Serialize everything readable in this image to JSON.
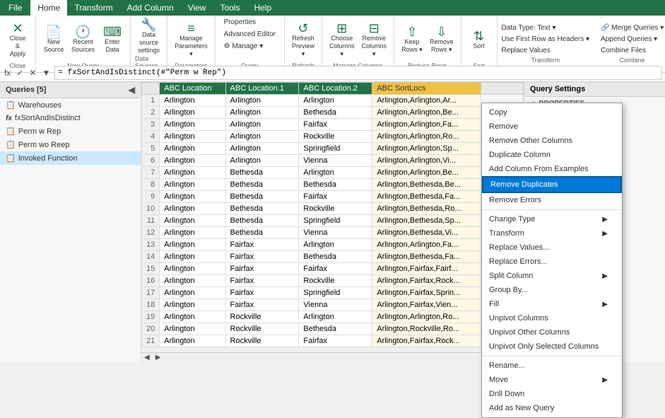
{
  "ribbon": {
    "tabs": [
      "File",
      "Home",
      "Transform",
      "Add Column",
      "View",
      "Tools",
      "Help"
    ],
    "active_tab": "Home",
    "groups": [
      {
        "label": "Close",
        "items": [
          {
            "label": "Close &\nApply",
            "icon": "✕"
          }
        ]
      },
      {
        "label": "New Query",
        "items": [
          {
            "label": "New\nSource",
            "icon": "📄"
          },
          {
            "label": "Recent\nSources",
            "icon": "🕐"
          },
          {
            "label": "Enter\nData",
            "icon": "⌨"
          }
        ]
      },
      {
        "label": "Data Sources",
        "items": [
          {
            "label": "Data source\nsettings",
            "icon": "🔧"
          }
        ]
      },
      {
        "label": "Parameters",
        "items": [
          {
            "label": "Manage\nParameters",
            "icon": "≡"
          }
        ]
      },
      {
        "label": "Query",
        "items": [
          {
            "label": "Properties",
            "icon": ""
          },
          {
            "label": "Advanced Editor",
            "icon": ""
          },
          {
            "label": "Manage ▾",
            "icon": ""
          }
        ]
      },
      {
        "label": "Refresh",
        "items": [
          {
            "label": "Refresh\nPreview ▾",
            "icon": "↺"
          }
        ]
      },
      {
        "label": "Manage Columns",
        "items": [
          {
            "label": "Choose\nColumns ▾",
            "icon": ""
          },
          {
            "label": "Remove\nColumns ▾",
            "icon": ""
          }
        ]
      },
      {
        "label": "Reduce Rows",
        "items": [
          {
            "label": "Keep\nRows ▾",
            "icon": ""
          },
          {
            "label": "Remove\nRows ▾",
            "icon": ""
          }
        ]
      },
      {
        "label": "Sort",
        "items": [
          {
            "label": "Sort",
            "icon": ""
          }
        ]
      }
    ]
  },
  "formula_bar": {
    "name_box_value": "= fxSortAndIsDistinct(#\"Perm w Rep\")",
    "formula_value": "= fxSortAndIsDistinct(#\"Perm w Rep\")"
  },
  "sidebar": {
    "header": "Queries [5]",
    "items": [
      {
        "label": "Warehouses",
        "icon": "📋",
        "active": false
      },
      {
        "label": "fxSortAndIsDistinct",
        "icon": "fx",
        "active": false
      },
      {
        "label": "Perm w Rep",
        "icon": "📋",
        "active": false
      },
      {
        "label": "Perm wo Reep",
        "icon": "📋",
        "active": false
      },
      {
        "label": "Invoked Function",
        "icon": "📋",
        "active": true
      }
    ]
  },
  "grid": {
    "columns": [
      "",
      "Location",
      "Location.1",
      "Location.2",
      "SortLocs"
    ],
    "rows": [
      [
        "1",
        "Arlington",
        "Arlington",
        "Arlington",
        "Arlington,Arlington,Ar..."
      ],
      [
        "2",
        "Arlington",
        "Arlington",
        "Bethesda",
        "Arlington,Arlington,Be..."
      ],
      [
        "3",
        "Arlington",
        "Arlington",
        "Fairfax",
        "Arlington,Arlington,Fa..."
      ],
      [
        "4",
        "Arlington",
        "Arlington",
        "Rockville",
        "Arlington,Arlington,Ro..."
      ],
      [
        "5",
        "Arlington",
        "Arlington",
        "Springfield",
        "Arlington,Arlington,Sp..."
      ],
      [
        "6",
        "Arlington",
        "Arlington",
        "Vienna",
        "Arlington,Arlington,Vi..."
      ],
      [
        "7",
        "Arlington",
        "Bethesda",
        "Arlington",
        "Arlington,Arlington,Be..."
      ],
      [
        "8",
        "Arlington",
        "Bethesda",
        "Bethesda",
        "Arlington,Bethesda,Be..."
      ],
      [
        "9",
        "Arlington",
        "Bethesda",
        "Fairfax",
        "Arlington,Bethesda,Fa..."
      ],
      [
        "10",
        "Arlington",
        "Bethesda",
        "Rockville",
        "Arlington,Bethesda,Ro..."
      ],
      [
        "11",
        "Arlington",
        "Bethesda",
        "Springfield",
        "Arlington,Bethesda,Sp..."
      ],
      [
        "12",
        "Arlington",
        "Bethesda",
        "Vienna",
        "Arlington,Bethesda,Vi..."
      ],
      [
        "13",
        "Arlington",
        "Fairfax",
        "Arlington",
        "Arlington,Arlington,Fa..."
      ],
      [
        "14",
        "Arlington",
        "Fairfax",
        "Bethesda",
        "Arlington,Bethesda,Fa..."
      ],
      [
        "15",
        "Arlington",
        "Fairfax",
        "Fairfax",
        "Arlington,Fairfax,Fairf..."
      ],
      [
        "16",
        "Arlington",
        "Fairfax",
        "Rockville",
        "Arlington,Fairfax,Rock..."
      ],
      [
        "17",
        "Arlington",
        "Fairfax",
        "Springfield",
        "Arlington,Fairfax,Sprin..."
      ],
      [
        "18",
        "Arlington",
        "Fairfax",
        "Vienna",
        "Arlington,Fairfax,Vien..."
      ],
      [
        "19",
        "Arlington",
        "Rockville",
        "Arlington",
        "Arlington,Arlington,Ro..."
      ],
      [
        "20",
        "Arlington",
        "Rockville",
        "Bethesda",
        "Arlington,Rockville,Ro..."
      ],
      [
        "21",
        "Arlington",
        "Rockville",
        "Fairfax",
        "Arlington,Fairfax,Rock..."
      ]
    ]
  },
  "context_menu": {
    "items": [
      {
        "label": "Copy",
        "has_arrow": false,
        "type": "item"
      },
      {
        "label": "Remove",
        "has_arrow": false,
        "type": "item"
      },
      {
        "label": "Remove Other Columns",
        "has_arrow": false,
        "type": "item"
      },
      {
        "label": "Duplicate Column",
        "has_arrow": false,
        "type": "item"
      },
      {
        "label": "Add Column From Examples",
        "has_arrow": false,
        "type": "item"
      },
      {
        "label": "Remove Duplicates",
        "has_arrow": false,
        "type": "highlighted"
      },
      {
        "label": "Remove Errors",
        "has_arrow": false,
        "type": "item"
      },
      {
        "type": "separator"
      },
      {
        "label": "Change Type",
        "has_arrow": true,
        "type": "item"
      },
      {
        "label": "Transform",
        "has_arrow": true,
        "type": "item"
      },
      {
        "label": "Replace Values...",
        "has_arrow": false,
        "type": "item"
      },
      {
        "label": "Replace Errors...",
        "has_arrow": false,
        "type": "item"
      },
      {
        "label": "Split Column",
        "has_arrow": true,
        "type": "item"
      },
      {
        "label": "Group By...",
        "has_arrow": false,
        "type": "item"
      },
      {
        "label": "Fill",
        "has_arrow": true,
        "type": "item"
      },
      {
        "label": "Unpivot Columns",
        "has_arrow": false,
        "type": "item"
      },
      {
        "label": "Unpivot Other Columns",
        "has_arrow": false,
        "type": "item"
      },
      {
        "label": "Unpivot Only Selected Columns",
        "has_arrow": false,
        "type": "item"
      },
      {
        "type": "separator"
      },
      {
        "label": "Rename...",
        "has_arrow": false,
        "type": "item"
      },
      {
        "label": "Move",
        "has_arrow": true,
        "type": "item"
      },
      {
        "label": "Drill Down",
        "has_arrow": false,
        "type": "item"
      },
      {
        "label": "Add as New Query",
        "has_arrow": false,
        "type": "item"
      }
    ]
  },
  "query_settings": {
    "header": "Query Settings",
    "properties_label": "▲ PROPERTIES"
  }
}
